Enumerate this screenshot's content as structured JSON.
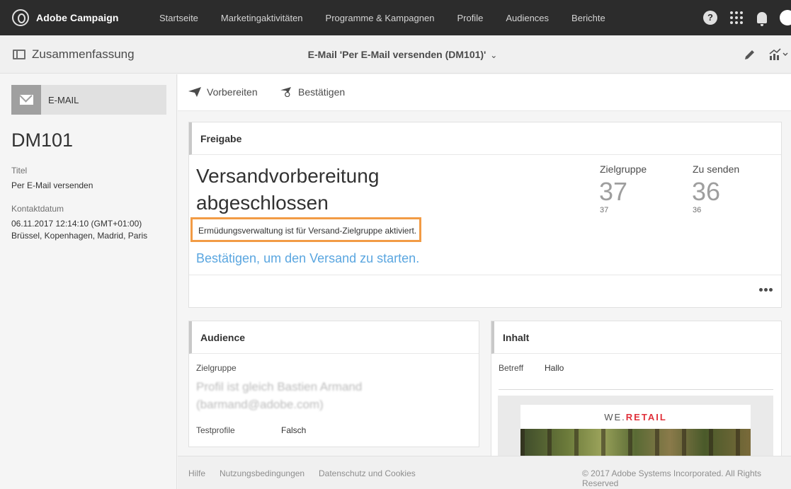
{
  "app": {
    "name": "Adobe Campaign"
  },
  "nav": [
    "Startseite",
    "Marketingaktivitäten",
    "Programme & Kampagnen",
    "Profile",
    "Audiences",
    "Berichte"
  ],
  "header": {
    "summary_title": "Zusammenfassung",
    "doc_title": "E-Mail 'Per E-Mail versenden (DM101)'",
    "doc_chevron": "⌄"
  },
  "sidebar": {
    "type_label": "E-MAIL",
    "code": "DM101",
    "title_label": "Titel",
    "title_value": "Per E-Mail versenden",
    "contact_label": "Kontaktdatum",
    "contact_value": "06.11.2017 12:14:10 (GMT+01:00) Brüssel, Kopenhagen, Madrid, Paris"
  },
  "toolbar": {
    "prepare_label": "Vorbereiten",
    "confirm_label": "Bestätigen"
  },
  "approval": {
    "heading": "Freigabe",
    "status": "Versandvorbereitung abgeschlossen",
    "warning": "Ermüdungsverwaltung ist für Versand-Zielgruppe aktiviert.",
    "confirm_link": "Bestätigen, um den Versand zu starten.",
    "target_label": "Zielgruppe",
    "target_big": "37",
    "target_small": "37",
    "tosend_label": "Zu senden",
    "tosend_big": "36",
    "tosend_small": "36"
  },
  "audience": {
    "heading": "Audience",
    "target_label": "Zielgruppe",
    "target_value": "Profil ist gleich Bastien Armand (barmand@adobe.com)",
    "test_label": "Testprofile",
    "test_value": "Falsch"
  },
  "content": {
    "heading": "Inhalt",
    "subject_label": "Betreff",
    "subject_value": "Hallo",
    "brand_prefix": "WE.",
    "brand_suffix": "RETAIL"
  },
  "footer": {
    "help": "Hilfe",
    "terms": "Nutzungsbedingungen",
    "privacy": "Datenschutz und Cookies",
    "copyright": "© 2017 Adobe Systems Incorporated. All Rights Reserved"
  },
  "colors": {
    "topbar": "#2c2c2c",
    "warning_border": "#f29b45",
    "link": "#5aa6e0",
    "brand_red": "#e0303a"
  },
  "icons": [
    "adobe-campaign-logo",
    "help-icon",
    "apps-grid-icon",
    "bell-icon",
    "panel-icon",
    "chevron-down-icon",
    "pencil-icon",
    "report-chart-icon",
    "envelope-icon",
    "paper-plane-icon",
    "paper-plane-check-icon",
    "more-icon"
  ]
}
